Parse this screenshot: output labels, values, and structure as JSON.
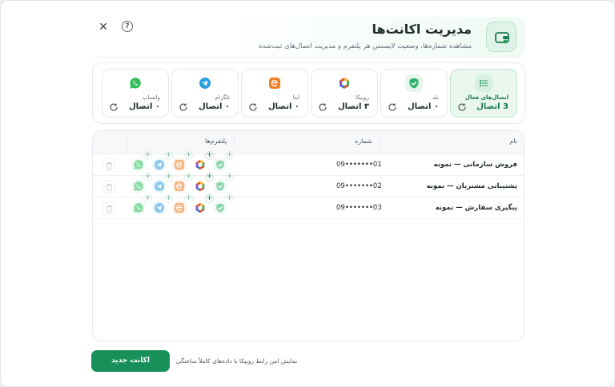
{
  "header": {
    "title": "مدیریت اکانت‌ها",
    "subtitle": "مشاهده شماره‌ها، وضعیت لایسنس هر پلتفرم و مدیریت اتصال‌های ثبت‌شده",
    "icon": "wallet-icon"
  },
  "controls": {
    "close_icon": "close-icon",
    "help_icon": "help-icon",
    "help_glyph": "?"
  },
  "cards": [
    {
      "key": "active",
      "name": "اتصال‌های فعال",
      "count": "3 اتصال",
      "icon": "list-icon",
      "color": "#2e9e62"
    },
    {
      "key": "bale",
      "name": "بله",
      "count": "۰ اتصال",
      "icon": "bale-icon",
      "color": "#2fb36f"
    },
    {
      "key": "rubika",
      "name": "روبیکا",
      "count": "۳ اتصال",
      "icon": "rubika-icon",
      "color": "#e0572a"
    },
    {
      "key": "eitaa",
      "name": "ایتا",
      "count": "۰ اتصال",
      "icon": "eitaa-icon",
      "color": "#f07d22"
    },
    {
      "key": "telegram",
      "name": "تلگرام",
      "count": "۰ اتصال",
      "icon": "telegram-icon",
      "color": "#2a9ee0"
    },
    {
      "key": "whatsapp",
      "name": "واتساپ",
      "count": "۰ اتصال",
      "icon": "whatsapp-icon",
      "color": "#2fbe5c"
    }
  ],
  "table": {
    "columns": {
      "name": "نام",
      "number": "شماره",
      "platforms": "پلتفرم‌ها"
    },
    "rows": [
      {
        "name": "فروش سازمانی — نمونه",
        "number": "09•••••••01"
      },
      {
        "name": "پشتیبانی مشتریان — نمونه",
        "number": "09•••••••02"
      },
      {
        "name": "پیگیری سفارش — نمونه",
        "number": "09•••••••03"
      }
    ]
  },
  "footer": {
    "new_account": "اکانت جدید",
    "note": "نمایش امن رابط روبیکا با داده‌های کاملاً ساختگی"
  },
  "colors": {
    "accent": "#17905a",
    "accent_light": "#e9f7ef"
  }
}
